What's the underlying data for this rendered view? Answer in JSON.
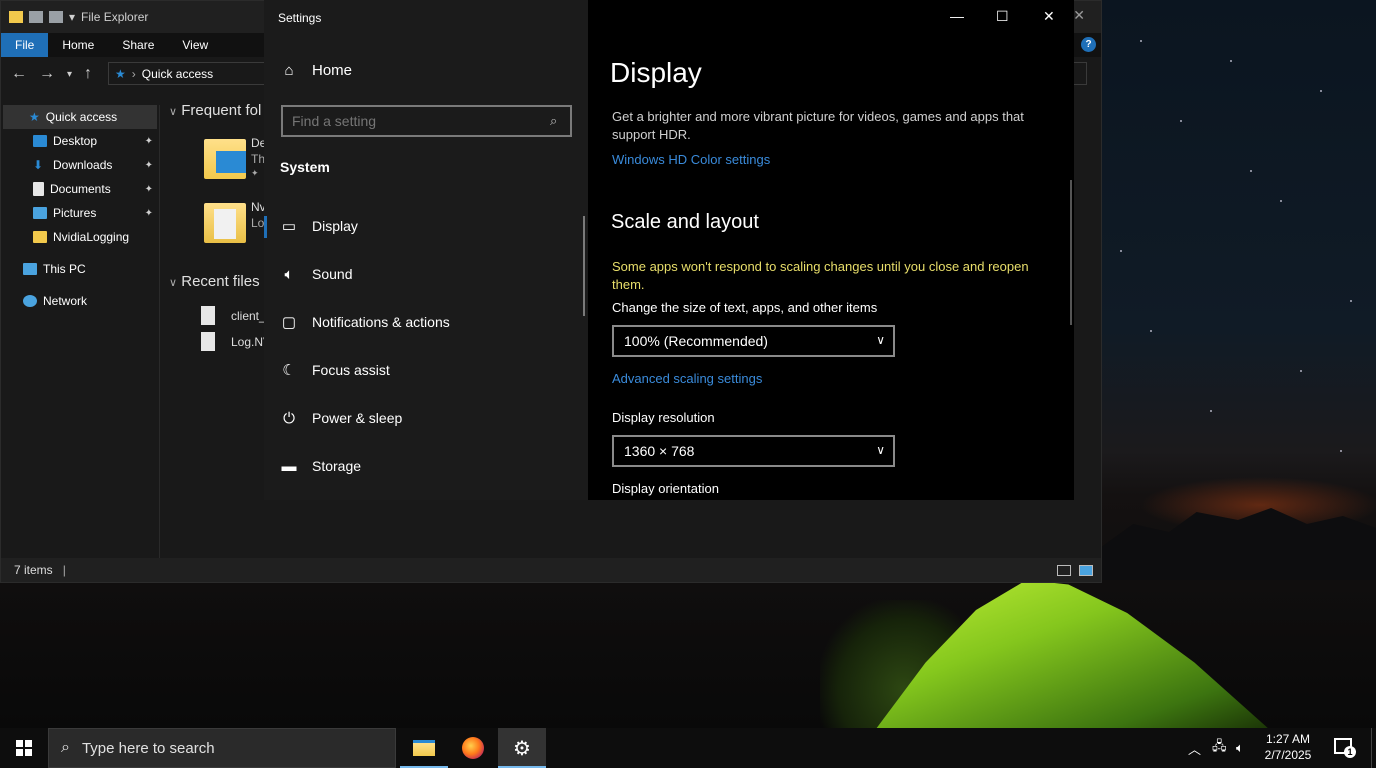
{
  "explorer": {
    "title": "File Explorer",
    "ribbon_tabs": [
      "File",
      "Home",
      "Share",
      "View"
    ],
    "address": "Quick access",
    "nav": [
      {
        "label": "Quick access",
        "icon": "star-icon",
        "pinned": false
      },
      {
        "label": "Desktop",
        "icon": "desktop-folder-icon",
        "pinned": true
      },
      {
        "label": "Downloads",
        "icon": "downloads-icon",
        "pinned": true
      },
      {
        "label": "Documents",
        "icon": "documents-icon",
        "pinned": true
      },
      {
        "label": "Pictures",
        "icon": "pictures-icon",
        "pinned": true
      },
      {
        "label": "NvidiaLogging",
        "icon": "folder-icon",
        "pinned": false
      },
      {
        "label": "This PC",
        "icon": "pc-icon",
        "pinned": false
      },
      {
        "label": "Network",
        "icon": "network-icon",
        "pinned": false
      }
    ],
    "frequent_header": "Frequent fol",
    "frequent_items": [
      {
        "line1": "De",
        "line2": "Th"
      },
      {
        "line1": "Nv",
        "line2": "Lo"
      }
    ],
    "recent_header": "Recent files",
    "recent_items": [
      "client_",
      "Log.NV"
    ],
    "status": "7 items"
  },
  "settings": {
    "window_title": "Settings",
    "home": "Home",
    "search_placeholder": "Find a setting",
    "category": "System",
    "nav": [
      {
        "label": "Display",
        "icon": "monitor-icon",
        "active": true
      },
      {
        "label": "Sound",
        "icon": "speaker-icon",
        "active": false
      },
      {
        "label": "Notifications & actions",
        "icon": "notifications-icon",
        "active": false
      },
      {
        "label": "Focus assist",
        "icon": "moon-icon",
        "active": false
      },
      {
        "label": "Power & sleep",
        "icon": "power-icon",
        "active": false
      },
      {
        "label": "Storage",
        "icon": "storage-icon",
        "active": false
      }
    ],
    "page_title": "Display",
    "hdr_text": "Get a brighter and more vibrant picture for videos, games and apps that support HDR.",
    "hdr_link": "Windows HD Color settings",
    "scale_heading": "Scale and layout",
    "scale_warning": "Some apps won't respond to scaling changes until you close and reopen them.",
    "scale_label": "Change the size of text, apps, and other items",
    "scale_value": "100% (Recommended)",
    "adv_link": "Advanced scaling settings",
    "resolution_label": "Display resolution",
    "resolution_value": "1360 × 768",
    "orientation_label": "Display orientation"
  },
  "taskbar": {
    "search_placeholder": "Type here to search",
    "apps": [
      "File Explorer",
      "Firefox",
      "Settings"
    ],
    "time": "1:27 AM",
    "date": "2/7/2025",
    "notification_count": "1"
  },
  "colors": {
    "accent": "#1f6fb7",
    "link": "#3a8bdb",
    "warning": "#e8de6a"
  }
}
